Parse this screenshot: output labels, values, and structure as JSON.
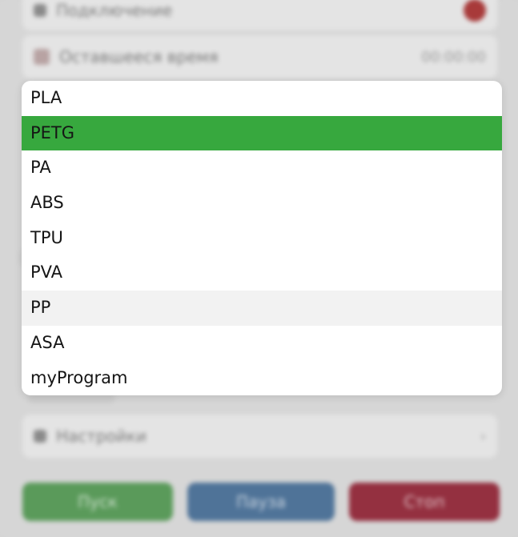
{
  "background": {
    "rows": [
      {
        "label": "Подключение",
        "value": ""
      },
      {
        "label": "Оставшееся время",
        "value": "00:00:00"
      },
      {
        "label": "Настройки",
        "value": "›"
      }
    ],
    "buttons": [
      {
        "label": "Пуск",
        "color": "#5a9a5a"
      },
      {
        "label": "Пауза",
        "color": "#4f7398"
      },
      {
        "label": "Стоп",
        "color": "#943040"
      }
    ]
  },
  "dropdown": {
    "selected": "PETG",
    "highlighted": "PP",
    "selected_color": "#37a83e",
    "options": [
      {
        "label": "PLA"
      },
      {
        "label": "PETG"
      },
      {
        "label": "PA"
      },
      {
        "label": "ABS"
      },
      {
        "label": "TPU"
      },
      {
        "label": "PVA"
      },
      {
        "label": "PP"
      },
      {
        "label": "ASA"
      },
      {
        "label": "myProgram"
      }
    ]
  }
}
